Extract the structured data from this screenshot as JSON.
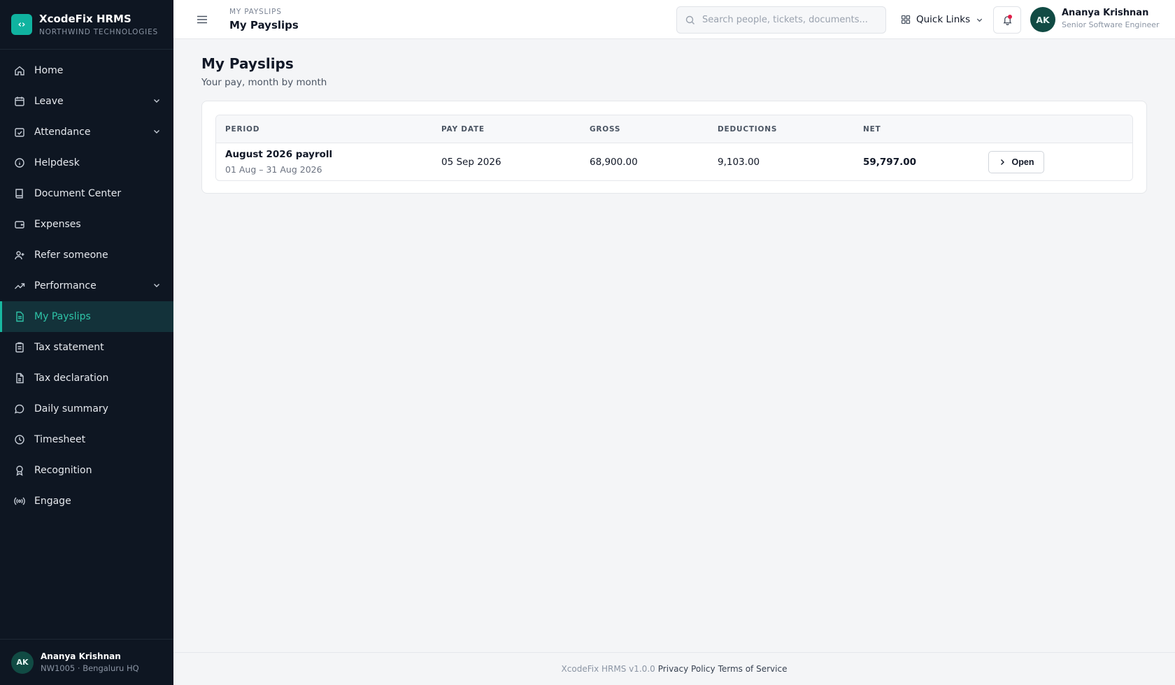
{
  "brand": {
    "logo_glyph": "‹›",
    "name": "XcodeFix HRMS",
    "org": "NORTHWIND TECHNOLOGIES",
    "accent": "#10b3a0"
  },
  "sidebar": {
    "items": [
      {
        "label": "Home",
        "icon": "home-icon"
      },
      {
        "label": "Leave",
        "icon": "calendar-icon",
        "expandable": true
      },
      {
        "label": "Attendance",
        "icon": "calendar-check-icon",
        "expandable": true
      },
      {
        "label": "Helpdesk",
        "icon": "info-icon"
      },
      {
        "label": "Document Center",
        "icon": "book-icon"
      },
      {
        "label": "Expenses",
        "icon": "wallet-icon"
      },
      {
        "label": "Refer someone",
        "icon": "user-plus-icon"
      },
      {
        "label": "Performance",
        "icon": "trending-up-icon",
        "expandable": true
      },
      {
        "label": "My Payslips",
        "icon": "file-text-icon",
        "active": true
      },
      {
        "label": "Tax statement",
        "icon": "clipboard-icon"
      },
      {
        "label": "Tax declaration",
        "icon": "file-icon"
      },
      {
        "label": "Daily summary",
        "icon": "chat-icon"
      },
      {
        "label": "Timesheet",
        "icon": "clock-icon"
      },
      {
        "label": "Recognition",
        "icon": "award-icon"
      },
      {
        "label": "Engage",
        "icon": "broadcast-icon"
      }
    ],
    "user": {
      "initials": "AK",
      "name": "Ananya Krishnan",
      "meta": "NW1005 · Bengaluru HQ"
    }
  },
  "topbar": {
    "breadcrumb": "MY PAYSLIPS",
    "title": "My Payslips",
    "search_placeholder": "Search people, tickets, documents...",
    "search_value": "",
    "quick_links": "Quick Links",
    "user": {
      "initials": "AK",
      "name": "Ananya Krishnan",
      "role": "Senior Software Engineer"
    }
  },
  "main": {
    "title": "My Payslips",
    "subtitle": "Your pay, month by month",
    "table": {
      "columns": [
        "PERIOD",
        "PAY DATE",
        "GROSS",
        "DEDUCTIONS",
        "NET"
      ],
      "rows": [
        {
          "period": "August 2026 payroll",
          "range": "01 Aug – 31 Aug 2026",
          "pay_date": "05 Sep 2026",
          "gross": "68,900.00",
          "deductions": "9,103.00",
          "net": "59,797.00",
          "action": "Open"
        }
      ]
    }
  },
  "footer": {
    "version": "XcodeFix HRMS v1.0.0",
    "privacy": "Privacy Policy",
    "terms": "Terms of Service"
  }
}
